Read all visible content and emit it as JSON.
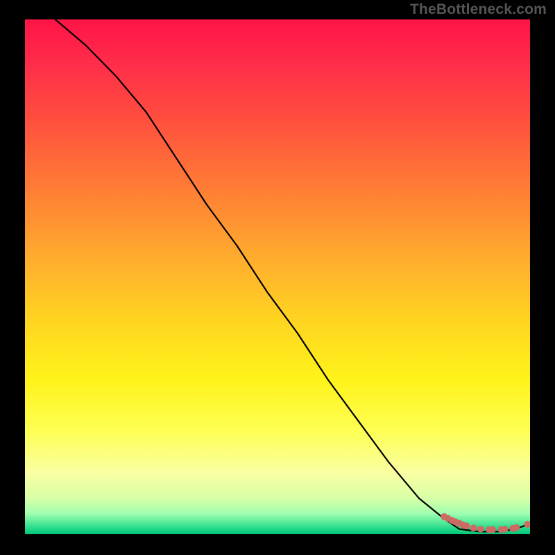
{
  "brand": "TheBottleneck.com",
  "chart_data": {
    "type": "line",
    "title": "",
    "xlabel": "",
    "ylabel": "",
    "xlim": [
      0,
      100
    ],
    "ylim": [
      0,
      100
    ],
    "grid": false,
    "line": {
      "name": "bottleneck-curve",
      "color": "#000000",
      "x": [
        0,
        6,
        12,
        18,
        24,
        30,
        36,
        42,
        48,
        54,
        60,
        66,
        72,
        78,
        83,
        86,
        90,
        94,
        97,
        100
      ],
      "values": [
        105,
        100,
        95,
        89,
        82,
        73,
        64,
        56,
        47,
        39,
        30,
        22,
        14,
        7,
        3,
        1,
        0.5,
        0.5,
        1,
        2
      ]
    },
    "scatter": {
      "name": "data-dots",
      "color": "#cc6b63",
      "radius": 5,
      "x": [
        83.0,
        83.7,
        84.5,
        85.2,
        86.0,
        86.7,
        87.4,
        88.8,
        90.2,
        91.9,
        92.6,
        94.3,
        95.0,
        96.6,
        97.3,
        99.5
      ],
      "y": [
        3.4,
        3.1,
        2.7,
        2.4,
        2.1,
        1.8,
        1.6,
        1.2,
        1.0,
        0.9,
        0.9,
        0.9,
        1.0,
        1.1,
        1.3,
        1.9
      ]
    }
  }
}
